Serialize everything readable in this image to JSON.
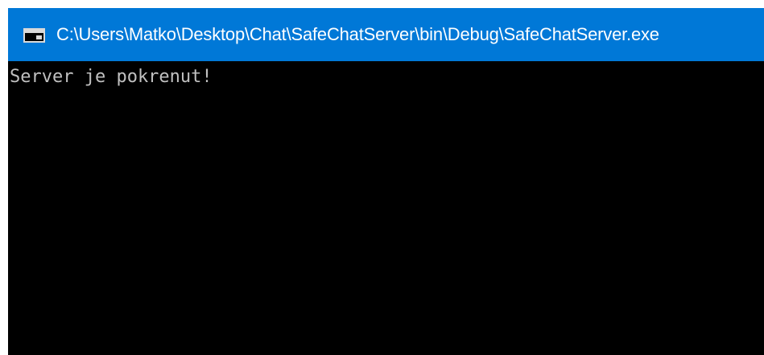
{
  "window": {
    "title": "C:\\Users\\Matko\\Desktop\\Chat\\SafeChatServer\\bin\\Debug\\SafeChatServer.exe",
    "icon": "console-app-icon",
    "titlebar_color": "#0078d7"
  },
  "console": {
    "background": "#000000",
    "text_color": "#c0c0c0",
    "lines": [
      "Server je pokrenut!"
    ]
  }
}
